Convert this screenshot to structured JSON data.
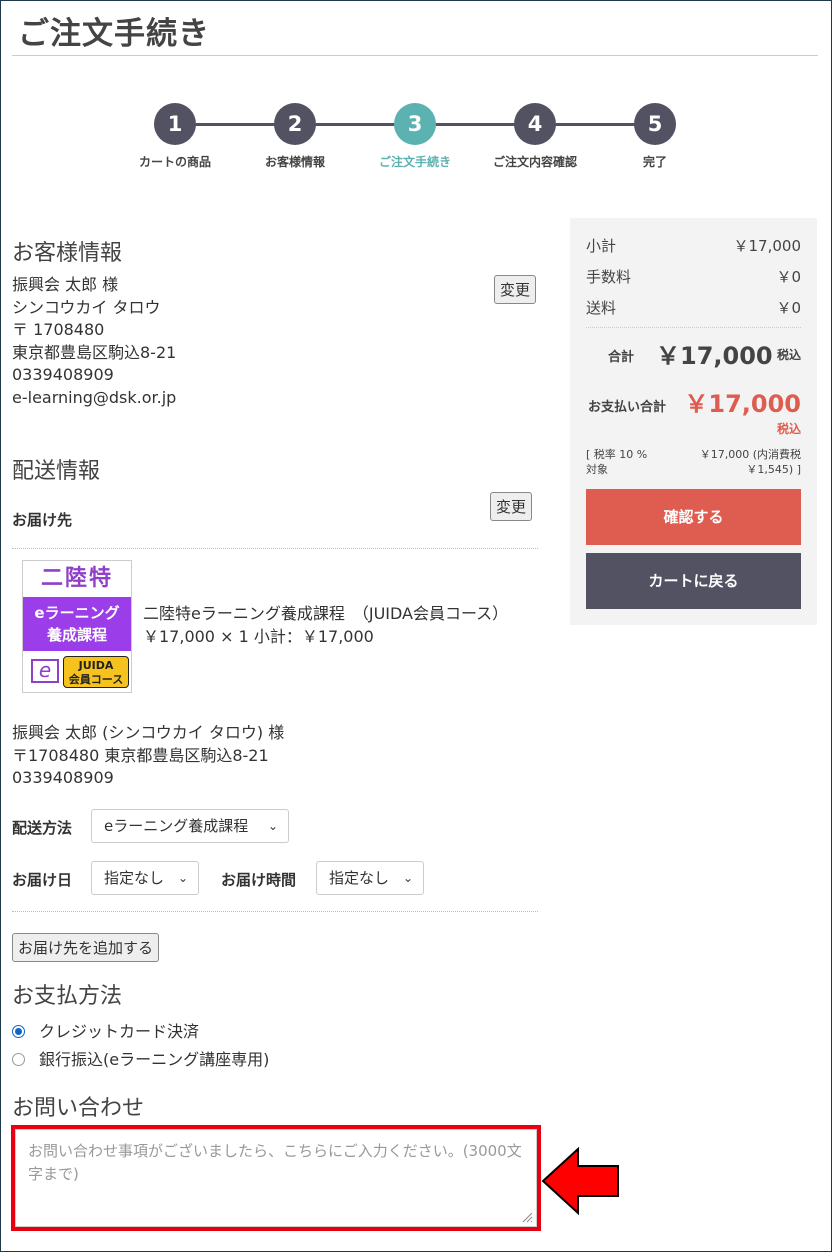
{
  "page_title": "ご注文手続き",
  "steps": [
    {
      "num": "1",
      "label": "カートの商品"
    },
    {
      "num": "2",
      "label": "お客様情報"
    },
    {
      "num": "3",
      "label": "ご注文手続き"
    },
    {
      "num": "4",
      "label": "ご注文内容確認"
    },
    {
      "num": "5",
      "label": "完了"
    }
  ],
  "colors": {
    "active_step": "#5cb1b1",
    "step": "#525263",
    "confirm_button": "#de5d50",
    "total_price": "#de5d50",
    "highlight_border": "#e60012"
  },
  "customer": {
    "section_title": "お客様情報",
    "name": "振興会 太郎 様",
    "kana": "シンコウカイ タロウ",
    "postal": "〒 1708480",
    "address": "東京都豊島区駒込8-21",
    "phone": "0339408909",
    "email": "e-learning@dsk.or.jp",
    "change_label": "変更"
  },
  "shipping": {
    "section_title": "配送情報",
    "destination_label": "お届け先",
    "change_label": "変更",
    "product_image": {
      "line1": "二陸特",
      "line2": "eラーニング",
      "line3": "養成課程",
      "badge_e": "e",
      "badge_line1": "JUIDA",
      "badge_line2": "会員コース"
    },
    "product_name": "二陸特eラーニング養成課程　（JUIDA会員コース）",
    "product_price": "￥17,000 × 1  小計：￥17,000",
    "recipient_name": "振興会 太郎 (シンコウカイ タロウ) 様",
    "recipient_address": "〒1708480 東京都豊島区駒込8-21",
    "recipient_phone": "0339408909",
    "method_label": "配送方法",
    "method_value": "eラーニング養成課程",
    "date_label": "お届け日",
    "date_value": "指定なし",
    "time_label": "お届け時間",
    "time_value": "指定なし",
    "add_destination_label": "お届け先を追加する"
  },
  "payment": {
    "section_title": "お支払方法",
    "options": [
      {
        "label": "クレジットカード決済",
        "checked": true
      },
      {
        "label": "銀行振込(eラーニング講座専用)",
        "checked": false
      }
    ]
  },
  "inquiry": {
    "section_title": "お問い合わせ",
    "placeholder": "お問い合わせ事項がございましたら、こちらにご入力ください。(3000文字まで)"
  },
  "summary": {
    "subtotal_label": "小計",
    "subtotal_value": "￥17,000",
    "fee_label": "手数料",
    "fee_value": "￥0",
    "shipping_label": "送料",
    "shipping_value": "￥0",
    "total_label": "合計",
    "total_value": "￥17,000",
    "total_tax": "税込",
    "payment_total_label": "お支払い合計",
    "payment_total_value": "￥17,000",
    "payment_total_tax": "税込",
    "tax_rate_line1": "[ 税率 10 %",
    "tax_rate_line2": "対象",
    "tax_amount_line1": "￥17,000 (内消費税",
    "tax_amount_line2": "￥1,545) ]",
    "confirm_label": "確認する",
    "back_label": "カートに戻る"
  }
}
